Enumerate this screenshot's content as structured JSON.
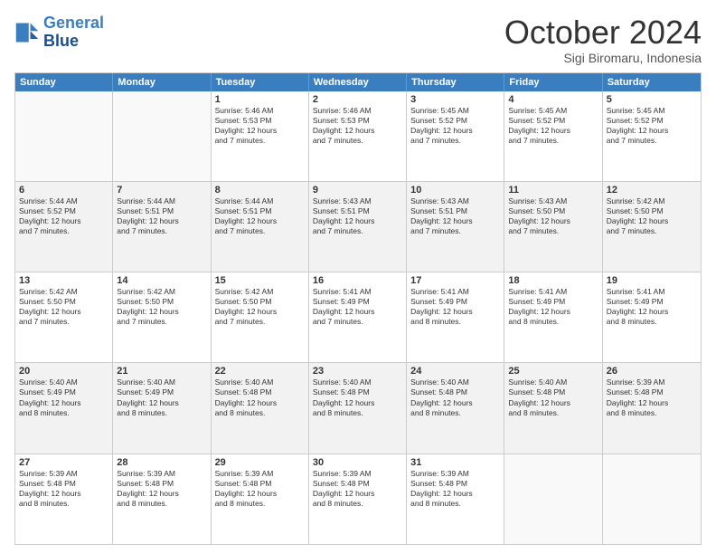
{
  "header": {
    "logo_line1": "General",
    "logo_line2": "Blue",
    "month": "October 2024",
    "location": "Sigi Biromaru, Indonesia"
  },
  "days": [
    "Sunday",
    "Monday",
    "Tuesday",
    "Wednesday",
    "Thursday",
    "Friday",
    "Saturday"
  ],
  "rows": [
    [
      {
        "num": "",
        "text": "",
        "empty": true
      },
      {
        "num": "",
        "text": "",
        "empty": true
      },
      {
        "num": "1",
        "text": "Sunrise: 5:46 AM\nSunset: 5:53 PM\nDaylight: 12 hours\nand 7 minutes."
      },
      {
        "num": "2",
        "text": "Sunrise: 5:46 AM\nSunset: 5:53 PM\nDaylight: 12 hours\nand 7 minutes."
      },
      {
        "num": "3",
        "text": "Sunrise: 5:45 AM\nSunset: 5:52 PM\nDaylight: 12 hours\nand 7 minutes."
      },
      {
        "num": "4",
        "text": "Sunrise: 5:45 AM\nSunset: 5:52 PM\nDaylight: 12 hours\nand 7 minutes."
      },
      {
        "num": "5",
        "text": "Sunrise: 5:45 AM\nSunset: 5:52 PM\nDaylight: 12 hours\nand 7 minutes."
      }
    ],
    [
      {
        "num": "6",
        "text": "Sunrise: 5:44 AM\nSunset: 5:52 PM\nDaylight: 12 hours\nand 7 minutes."
      },
      {
        "num": "7",
        "text": "Sunrise: 5:44 AM\nSunset: 5:51 PM\nDaylight: 12 hours\nand 7 minutes."
      },
      {
        "num": "8",
        "text": "Sunrise: 5:44 AM\nSunset: 5:51 PM\nDaylight: 12 hours\nand 7 minutes."
      },
      {
        "num": "9",
        "text": "Sunrise: 5:43 AM\nSunset: 5:51 PM\nDaylight: 12 hours\nand 7 minutes."
      },
      {
        "num": "10",
        "text": "Sunrise: 5:43 AM\nSunset: 5:51 PM\nDaylight: 12 hours\nand 7 minutes."
      },
      {
        "num": "11",
        "text": "Sunrise: 5:43 AM\nSunset: 5:50 PM\nDaylight: 12 hours\nand 7 minutes."
      },
      {
        "num": "12",
        "text": "Sunrise: 5:42 AM\nSunset: 5:50 PM\nDaylight: 12 hours\nand 7 minutes."
      }
    ],
    [
      {
        "num": "13",
        "text": "Sunrise: 5:42 AM\nSunset: 5:50 PM\nDaylight: 12 hours\nand 7 minutes."
      },
      {
        "num": "14",
        "text": "Sunrise: 5:42 AM\nSunset: 5:50 PM\nDaylight: 12 hours\nand 7 minutes."
      },
      {
        "num": "15",
        "text": "Sunrise: 5:42 AM\nSunset: 5:50 PM\nDaylight: 12 hours\nand 7 minutes."
      },
      {
        "num": "16",
        "text": "Sunrise: 5:41 AM\nSunset: 5:49 PM\nDaylight: 12 hours\nand 7 minutes."
      },
      {
        "num": "17",
        "text": "Sunrise: 5:41 AM\nSunset: 5:49 PM\nDaylight: 12 hours\nand 8 minutes."
      },
      {
        "num": "18",
        "text": "Sunrise: 5:41 AM\nSunset: 5:49 PM\nDaylight: 12 hours\nand 8 minutes."
      },
      {
        "num": "19",
        "text": "Sunrise: 5:41 AM\nSunset: 5:49 PM\nDaylight: 12 hours\nand 8 minutes."
      }
    ],
    [
      {
        "num": "20",
        "text": "Sunrise: 5:40 AM\nSunset: 5:49 PM\nDaylight: 12 hours\nand 8 minutes."
      },
      {
        "num": "21",
        "text": "Sunrise: 5:40 AM\nSunset: 5:49 PM\nDaylight: 12 hours\nand 8 minutes."
      },
      {
        "num": "22",
        "text": "Sunrise: 5:40 AM\nSunset: 5:48 PM\nDaylight: 12 hours\nand 8 minutes."
      },
      {
        "num": "23",
        "text": "Sunrise: 5:40 AM\nSunset: 5:48 PM\nDaylight: 12 hours\nand 8 minutes."
      },
      {
        "num": "24",
        "text": "Sunrise: 5:40 AM\nSunset: 5:48 PM\nDaylight: 12 hours\nand 8 minutes."
      },
      {
        "num": "25",
        "text": "Sunrise: 5:40 AM\nSunset: 5:48 PM\nDaylight: 12 hours\nand 8 minutes."
      },
      {
        "num": "26",
        "text": "Sunrise: 5:39 AM\nSunset: 5:48 PM\nDaylight: 12 hours\nand 8 minutes."
      }
    ],
    [
      {
        "num": "27",
        "text": "Sunrise: 5:39 AM\nSunset: 5:48 PM\nDaylight: 12 hours\nand 8 minutes."
      },
      {
        "num": "28",
        "text": "Sunrise: 5:39 AM\nSunset: 5:48 PM\nDaylight: 12 hours\nand 8 minutes."
      },
      {
        "num": "29",
        "text": "Sunrise: 5:39 AM\nSunset: 5:48 PM\nDaylight: 12 hours\nand 8 minutes."
      },
      {
        "num": "30",
        "text": "Sunrise: 5:39 AM\nSunset: 5:48 PM\nDaylight: 12 hours\nand 8 minutes."
      },
      {
        "num": "31",
        "text": "Sunrise: 5:39 AM\nSunset: 5:48 PM\nDaylight: 12 hours\nand 8 minutes."
      },
      {
        "num": "",
        "text": "",
        "empty": true
      },
      {
        "num": "",
        "text": "",
        "empty": true
      }
    ]
  ]
}
